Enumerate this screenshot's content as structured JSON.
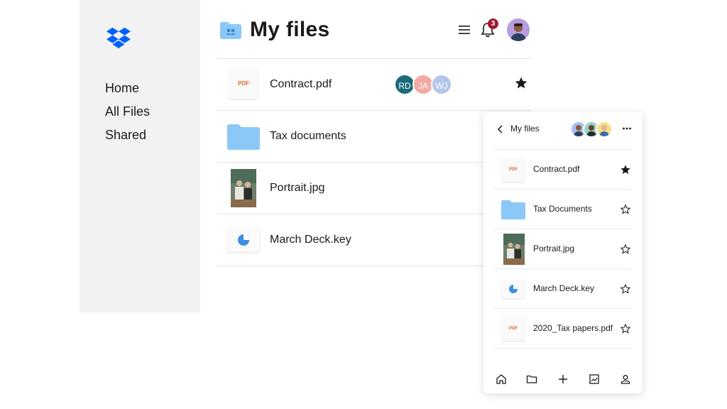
{
  "sidebar": {
    "logo_icon": "dropbox-logo",
    "nav_items": [
      {
        "label": "Home"
      },
      {
        "label": "All Files"
      },
      {
        "label": "Shared"
      }
    ]
  },
  "header": {
    "title": "My files",
    "title_icon": "shared-folder-icon",
    "menu_icon": "hamburger-menu-icon",
    "notifications_icon": "bell-icon",
    "notification_count": "3",
    "avatar_icon": "user-avatar"
  },
  "files": [
    {
      "name": "Contract.pdf",
      "type": "pdf",
      "thumb_label": "PDF",
      "starred": true,
      "collaborators": [
        {
          "initials": "RD",
          "color": "#1d6b79"
        },
        {
          "initials": "JA",
          "color": "#f4a9a3"
        },
        {
          "initials": "WJ",
          "color": "#b5c6ea"
        }
      ]
    },
    {
      "name": "Tax documents",
      "type": "folder"
    },
    {
      "name": "Portrait.jpg",
      "type": "image"
    },
    {
      "name": "March Deck.key",
      "type": "keynote"
    }
  ],
  "mobile_panel": {
    "title": "My files",
    "back_icon": "chevron-left-icon",
    "more_icon": "more-horizontal-icon",
    "files": [
      {
        "name": "Contract.pdf",
        "type": "pdf",
        "thumb_label": "PDF",
        "starred": true
      },
      {
        "name": "Tax Documents",
        "type": "folder",
        "starred": false
      },
      {
        "name": "Portrait.jpg",
        "type": "image",
        "starred": false
      },
      {
        "name": "March Deck.key",
        "type": "keynote",
        "starred": false
      },
      {
        "name": "2020_Tax papers.pdf",
        "type": "pdf",
        "thumb_label": "PDF",
        "starred": false
      }
    ],
    "bottom_nav": [
      "home-icon",
      "folder-icon",
      "plus-icon",
      "photos-icon",
      "account-icon"
    ]
  },
  "colors": {
    "brand_blue": "#0061fe",
    "folder_blue": "#8cc8f7",
    "badge_red": "#9b1b30",
    "sidebar_bg": "#f2f2f2"
  }
}
